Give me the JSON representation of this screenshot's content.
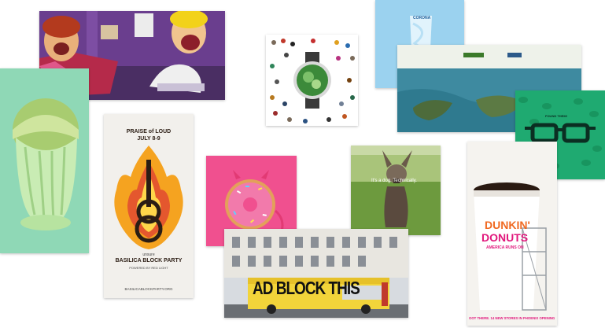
{
  "gallery": {
    "cards": [
      {
        "id": "purple-room"
      },
      {
        "id": "melon"
      },
      {
        "id": "basilica",
        "top_line": "PRAISE of LOUD",
        "date": "JULY 8-9",
        "small": "unsure",
        "name": "BASILICA BLOCK PARTY",
        "sub": "POWERED BY RED LIGHT",
        "url": "BASILICABLOCKPARTY.ORG"
      },
      {
        "id": "smartwatch"
      },
      {
        "id": "soda-glass",
        "brand": "CORONA"
      },
      {
        "id": "island-aerial"
      },
      {
        "id": "green-glasses",
        "caption": "FOUND THEM!"
      },
      {
        "id": "donut"
      },
      {
        "id": "dog",
        "caption": "It's a dog. Technically."
      },
      {
        "id": "bus",
        "slogan": "AD BLOCK THIS"
      },
      {
        "id": "dunkin",
        "brand_top": "DUNKIN'",
        "brand_bottom": "DONUTS",
        "tagline": "AMERICA RUNS ON",
        "footer": "OOT THERE. 14 NEW STORES IN PHOENIX OPENING"
      }
    ]
  },
  "colors": {
    "purple_wall": "#6a3e8e",
    "melon_bg": "#8fd8b6",
    "pink": "#f0508f",
    "green_bg": "#1faa71",
    "dunkin_orange": "#f06a22",
    "dunkin_pink": "#e1177c"
  }
}
